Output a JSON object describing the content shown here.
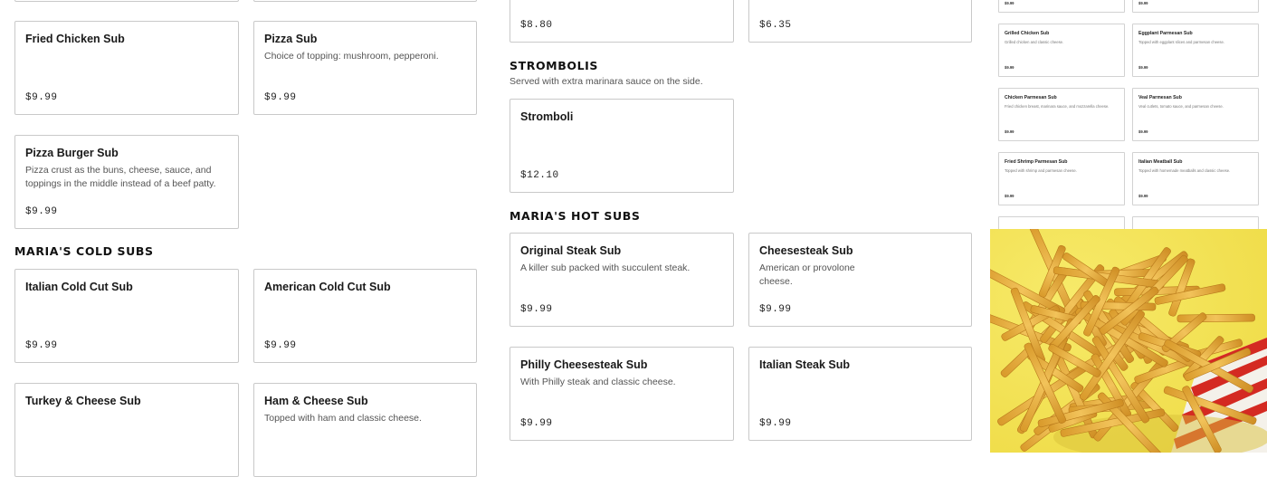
{
  "left_column": {
    "top_items": [
      {
        "name": "Fried Chicken Sub",
        "description": "",
        "price": "$9.99"
      },
      {
        "name": "Pizza Sub",
        "description": "Choice of topping: mushroom, pepperoni.",
        "price": "$9.99"
      },
      {
        "name": "Pizza Burger Sub",
        "description": "Pizza crust as the buns, cheese, sauce, and toppings in the middle instead of a beef patty.",
        "price": "$9.99"
      }
    ],
    "cold_subs": {
      "title": "MARIA'S COLD SUBS",
      "items": [
        {
          "name": "Italian Cold Cut Sub",
          "description": "",
          "price": "$9.99"
        },
        {
          "name": "American Cold Cut Sub",
          "description": "",
          "price": "$9.99"
        },
        {
          "name": "Turkey & Cheese Sub",
          "description": "",
          "price": ""
        },
        {
          "name": "Ham & Cheese Sub",
          "description": "Topped with ham and classic cheese.",
          "price": ""
        }
      ]
    }
  },
  "middle_column": {
    "top_prices": [
      "$8.80",
      "$6.35"
    ],
    "strombolis": {
      "title": "STROMBOLIS",
      "subtitle": "Served with extra marinara sauce on the side.",
      "items": [
        {
          "name": "Stromboli",
          "description": "",
          "price": "$12.10"
        }
      ]
    },
    "hot_subs": {
      "title": "MARIA'S HOT SUBS",
      "items": [
        {
          "name": "Original Steak Sub",
          "description": "A killer sub packed with succulent steak.",
          "price": "$9.99"
        },
        {
          "name": "Cheesesteak Sub",
          "description": "American or provolone cheese.",
          "price": "$9.99"
        },
        {
          "name": "Philly Cheesesteak Sub",
          "description": "With Philly steak and classic cheese.",
          "price": "$9.99"
        },
        {
          "name": "Italian Steak Sub",
          "description": "",
          "price": "$9.99"
        }
      ]
    }
  },
  "right_column": {
    "top_prices": [
      "$9.99",
      "$9.99"
    ],
    "items": [
      {
        "name": "Grilled Chicken Sub",
        "description": "Grilled chicken and classic cheese.",
        "price": "$9.99"
      },
      {
        "name": "Eggplant Parmesan Sub",
        "description": "Topped with eggplant slices and parmesan cheese.",
        "price": "$9.99"
      },
      {
        "name": "Chicken Parmesan Sub",
        "description": "Fried chicken breast, marinara sauce, and mozzarella cheese.",
        "price": "$9.99"
      },
      {
        "name": "Veal Parmesan Sub",
        "description": "Veal cutlets, tomato sauce, and parmesan cheese.",
        "price": "$9.99"
      },
      {
        "name": "Fried Shrimp Parmesan Sub",
        "description": "Topped with shrimp and parmesan cheese.",
        "price": "$9.99"
      },
      {
        "name": "Italian Meatball Sub",
        "description": "Topped with homemade meatballs and classic cheese.",
        "price": "$9.99"
      }
    ]
  },
  "colors": {
    "background": "#ffffff",
    "card_border": "#c9c9c9",
    "photo_background": "#f2e35a",
    "fries": "#e8b54a",
    "tray": "#d42a22"
  }
}
